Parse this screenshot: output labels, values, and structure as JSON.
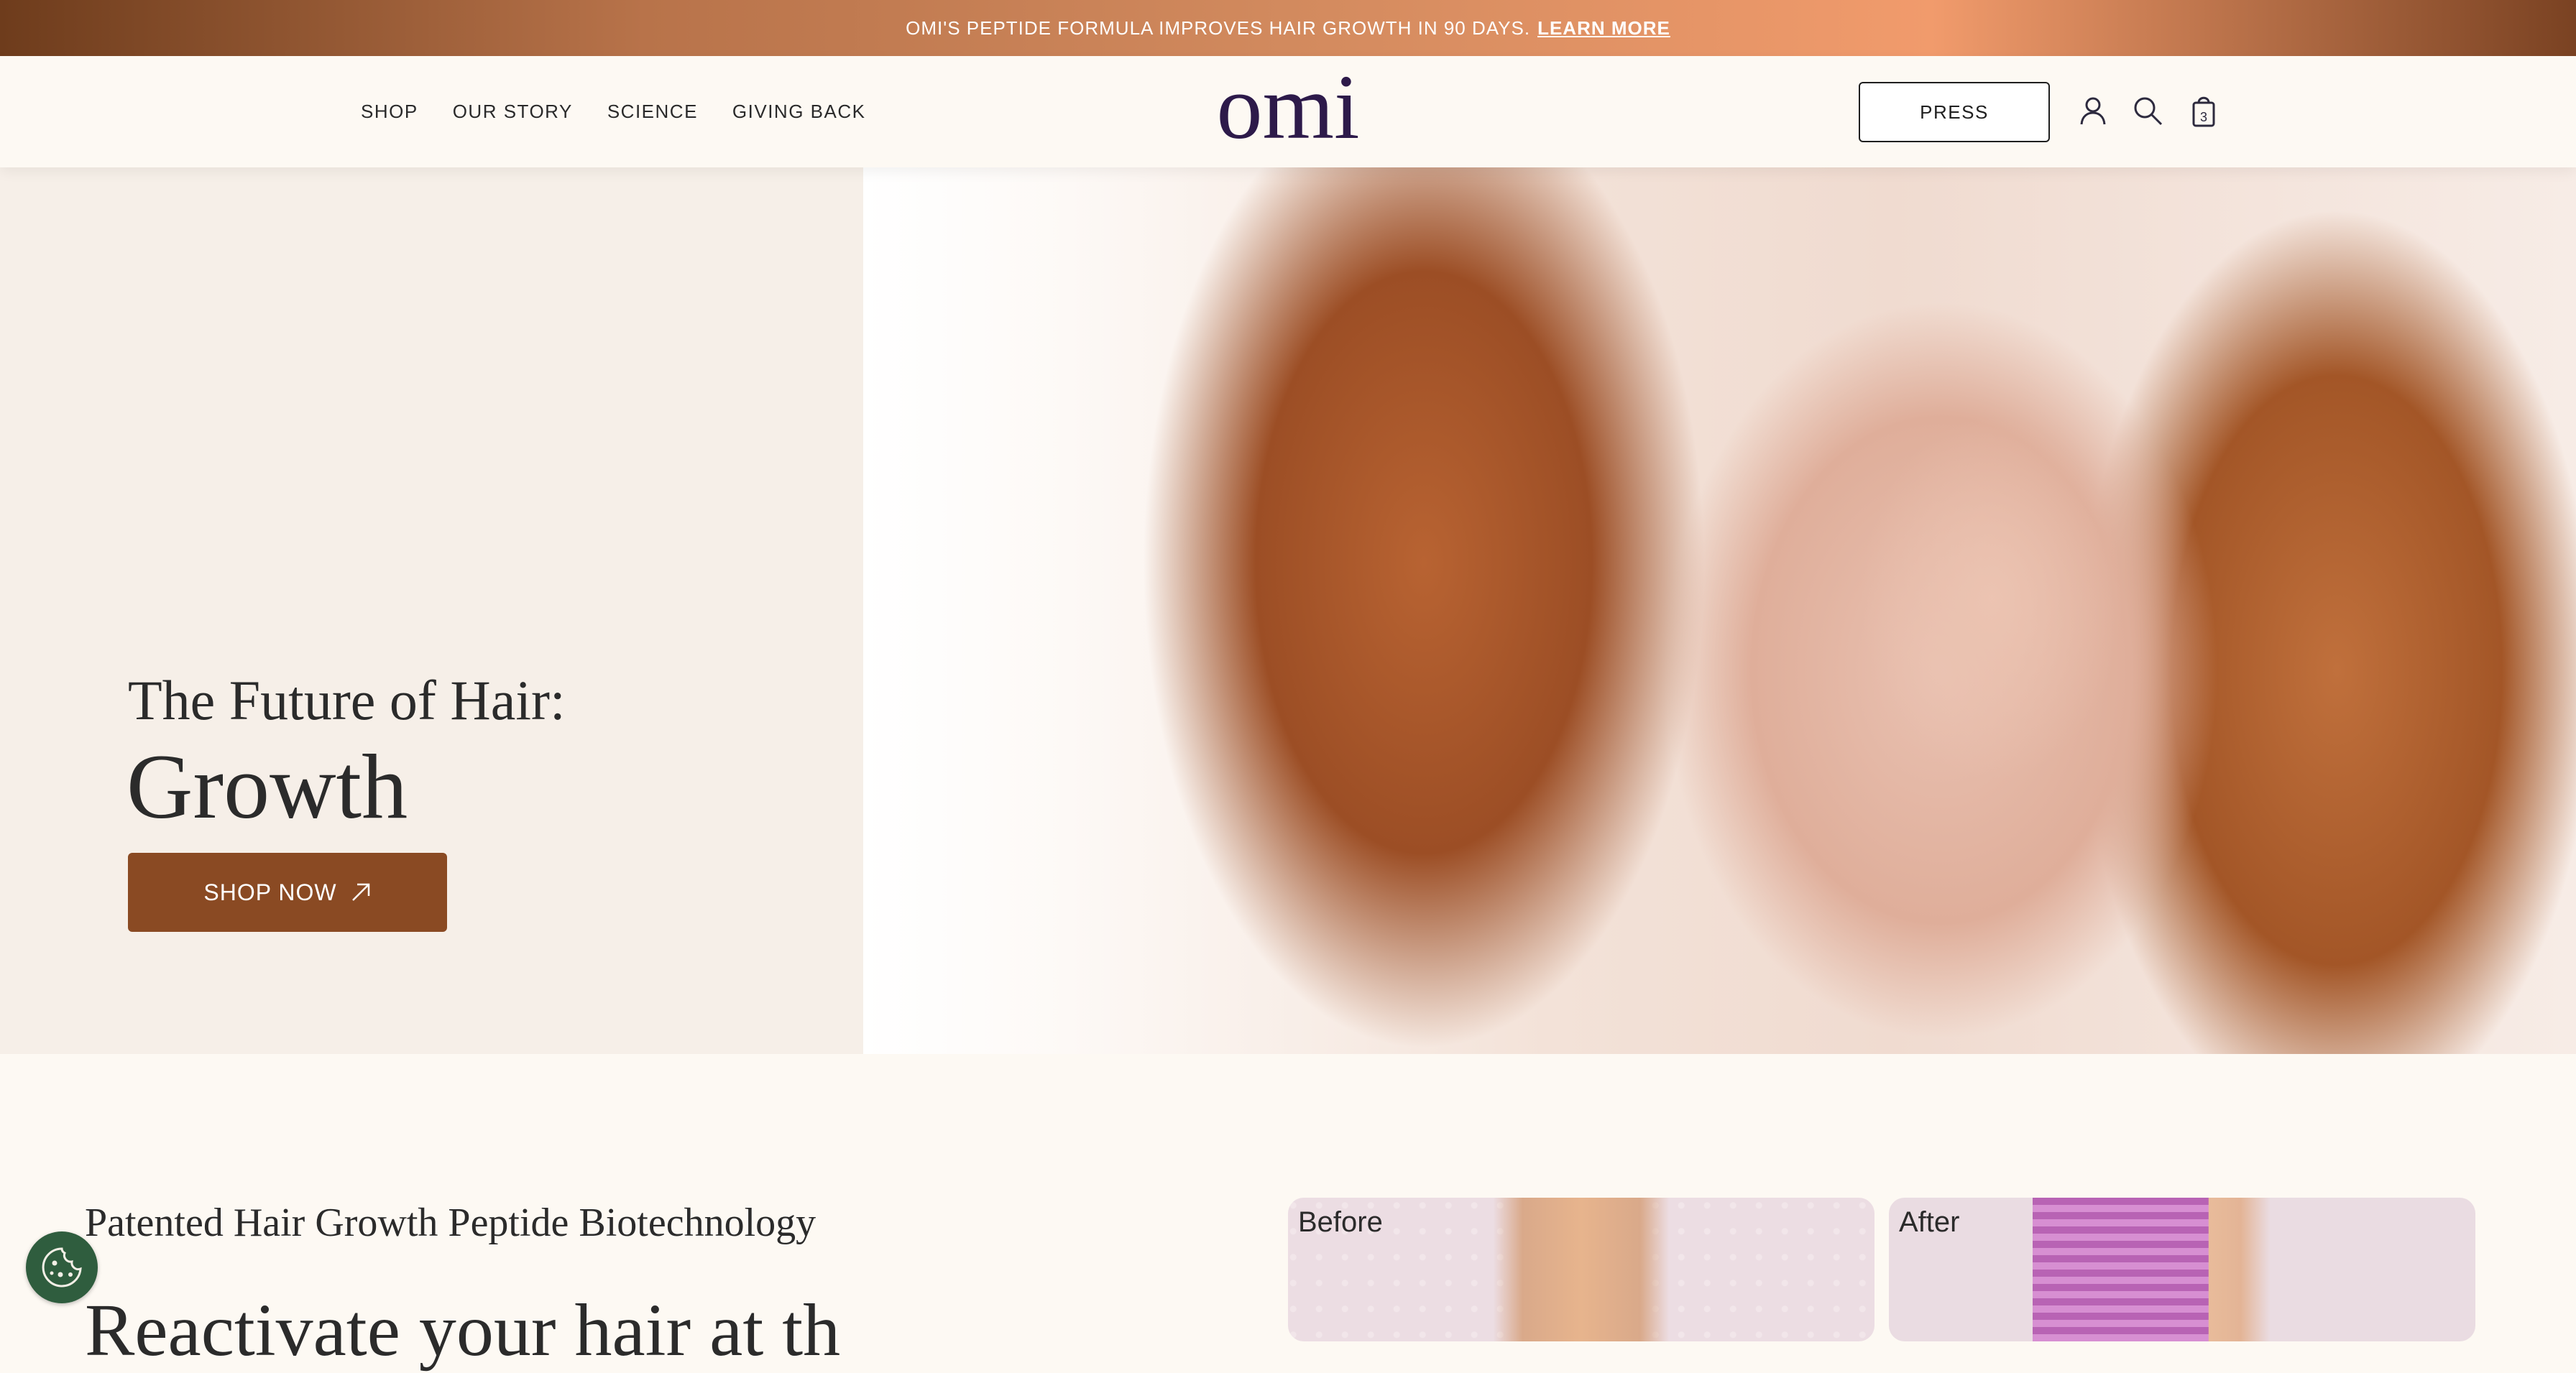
{
  "announcement": {
    "text": "OMI'S PEPTIDE FORMULA IMPROVES HAIR GROWTH IN 90 DAYS.",
    "link": "LEARN MORE"
  },
  "header": {
    "nav": [
      "SHOP",
      "OUR STORY",
      "SCIENCE",
      "GIVING BACK"
    ],
    "logo_text": "omi",
    "press_label": "PRESS",
    "cart_count": "3",
    "icons": [
      "account-icon",
      "search-icon",
      "cart-bag-icon"
    ]
  },
  "hero": {
    "title": "The Future of Hair:",
    "rotating_word": "Growth",
    "cta": "SHOP NOW"
  },
  "section": {
    "subtitle": "Patented Hair Growth Peptide Biotechnology",
    "heading": "Reactivate your hair at th",
    "before_label": "Before",
    "after_label": "After"
  },
  "colors": {
    "cta": "#8a4a23",
    "logo": "#2d1a4a",
    "cookie": "#2f5d3e"
  }
}
